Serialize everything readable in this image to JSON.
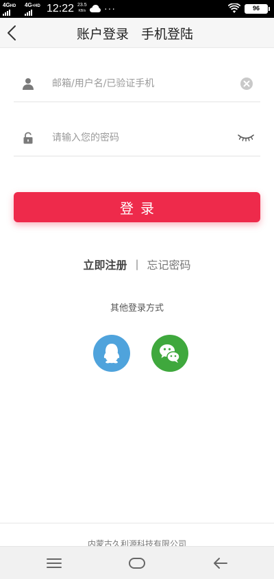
{
  "status_bar": {
    "sim1": "4G",
    "sim1_sup": "HD",
    "sim2": "4G",
    "sim2_sup": "+HD",
    "time": "12:22",
    "speed_value": "23.5",
    "speed_unit": "KB/s",
    "more": "···",
    "battery": "96"
  },
  "header": {
    "tab_account": "账户登录",
    "tab_phone": "手机登陆"
  },
  "form": {
    "username_placeholder": "邮箱/用户名/已验证手机",
    "password_placeholder": "请输入您的密码",
    "login_label": "登录"
  },
  "links": {
    "register": "立即注册",
    "separator": "|",
    "forgot": "忘记密码"
  },
  "other_login": {
    "title": "其他登录方式",
    "options": [
      "qq-icon",
      "wechat-icon"
    ]
  },
  "footer": {
    "company": "内蒙古久利源科技有限公司"
  },
  "colors": {
    "accent": "#ee2a4b",
    "qq": "#4fa3dc",
    "wechat": "#3fa83d"
  }
}
